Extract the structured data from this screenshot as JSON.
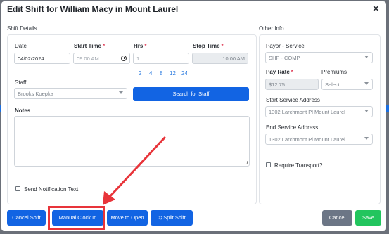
{
  "dialog": {
    "title": "Edit Shift for William Macy in Mount Laurel",
    "close_icon": "close-icon"
  },
  "shift_details": {
    "section_label": "Shift Details",
    "date": {
      "label": "Date",
      "value": "04/02/2024"
    },
    "start_time": {
      "label": "Start Time",
      "required": "*",
      "placeholder": "09:00 AM",
      "icon": "clock-icon"
    },
    "hrs": {
      "label": "Hrs",
      "required": "*",
      "value": "1",
      "quick_options": [
        "2",
        "4",
        "8",
        "12",
        "24"
      ]
    },
    "stop_time": {
      "label": "Stop Time",
      "required": "*",
      "value": "10:00 AM"
    },
    "staff": {
      "label": "Staff",
      "value": "Brooks Koepka"
    },
    "search_staff_button": "Search for Staff",
    "notes": {
      "label": "Notes",
      "value": ""
    },
    "send_notification": {
      "label": "Send Notification Text",
      "checked": false
    }
  },
  "other_info": {
    "section_label": "Other Info",
    "payor_service": {
      "label": "Payor - Service",
      "value": "SHP - COMP"
    },
    "pay_rate": {
      "label": "Pay Rate",
      "required": "*",
      "value": "$12.75"
    },
    "premiums": {
      "label": "Premiums",
      "placeholder": "Select"
    },
    "start_service_address": {
      "label": "Start Service Address",
      "value": "1302 Larchmont Pl Mount Laurel"
    },
    "end_service_address": {
      "label": "End Service Address",
      "value": "1302 Larchmont Pl Mount Laurel"
    },
    "require_transport": {
      "label": "Require Transport?",
      "checked": false
    }
  },
  "footer": {
    "cancel_shift": "Cancel Shift",
    "manual_clock_in": "Manual Clock In",
    "move_to_open": "Move to Open",
    "split_shift": "Split Shift",
    "split_shift_icon": "shuffle-icon",
    "cancel": "Cancel",
    "save": "Save"
  },
  "annotation": {
    "highlight_color": "#e8343a",
    "target": "Manual Clock In"
  },
  "colors": {
    "primary": "#1264e3",
    "secondary": "#6c7686",
    "success": "#22c55e",
    "required": "#e0405a",
    "link": "#2f7de0"
  }
}
